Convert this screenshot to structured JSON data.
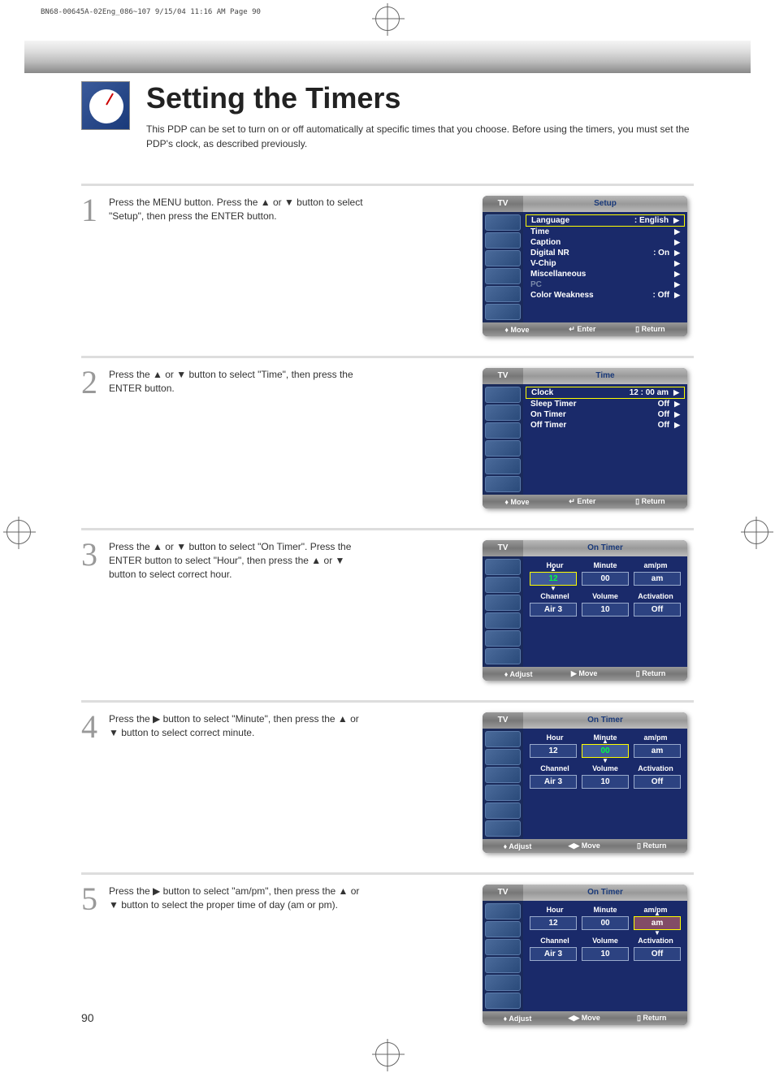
{
  "header_strip": "BN68-00645A-02Eng_086~107  9/15/04  11:16 AM  Page 90",
  "title": "Setting the Timers",
  "intro": "This PDP can be set to turn on or off automatically at specific times that you choose. Before using the timers, you must set the PDP's clock, as described previously.",
  "page_num": "90",
  "steps": [
    {
      "num": "1",
      "text": "Press the MENU button. Press the ▲ or ▼ button to select \"Setup\", then press the ENTER button."
    },
    {
      "num": "2",
      "text": "Press the ▲ or ▼ button to select \"Time\", then press the ENTER button."
    },
    {
      "num": "3",
      "text": "Press the ▲ or ▼ button to select \"On Timer\". Press the ENTER button to select \"Hour\", then press the ▲ or ▼ button to select correct hour."
    },
    {
      "num": "4",
      "text": "Press the ▶ button to select \"Minute\", then press the ▲ or ▼ button to select correct minute."
    },
    {
      "num": "5",
      "text": "Press the ▶ button to select \"am/pm\", then press the ▲ or ▼ button to select the proper time of day (am or pm)."
    }
  ],
  "osd_tab": "TV",
  "footer": {
    "move": "Move",
    "enter": "Enter",
    "return": "Return",
    "adjust": "Adjust",
    "move2": "Move"
  },
  "setup_menu": {
    "title": "Setup",
    "rows": [
      {
        "label": "Language",
        "val": ": English",
        "sel": true
      },
      {
        "label": "Time",
        "val": ""
      },
      {
        "label": "Caption",
        "val": ""
      },
      {
        "label": "Digital NR",
        "val": ": On"
      },
      {
        "label": "V-Chip",
        "val": ""
      },
      {
        "label": "Miscellaneous",
        "val": ""
      },
      {
        "label": "PC",
        "val": "",
        "disabled": true
      },
      {
        "label": "Color Weakness",
        "val": ": Off"
      }
    ]
  },
  "time_menu": {
    "title": "Time",
    "rows": [
      {
        "label": "Clock",
        "val": "12 : 00 am",
        "sel": true
      },
      {
        "label": "Sleep Timer",
        "val": "Off"
      },
      {
        "label": "On Timer",
        "val": "Off"
      },
      {
        "label": "Off Timer",
        "val": "Off"
      }
    ]
  },
  "timer": {
    "title": "On Timer",
    "labels1": [
      "Hour",
      "Minute",
      "am/pm"
    ],
    "labels2": [
      "Channel",
      "Volume",
      "Activation"
    ],
    "row2": [
      "Air  3",
      "10",
      "Off"
    ],
    "s3": {
      "vals": [
        "12",
        "00",
        "am"
      ],
      "sel": 0
    },
    "s4": {
      "vals": [
        "12",
        "00",
        "am"
      ],
      "sel": 1
    },
    "s5": {
      "vals": [
        "12",
        "00",
        "am"
      ],
      "sel": 2
    }
  }
}
